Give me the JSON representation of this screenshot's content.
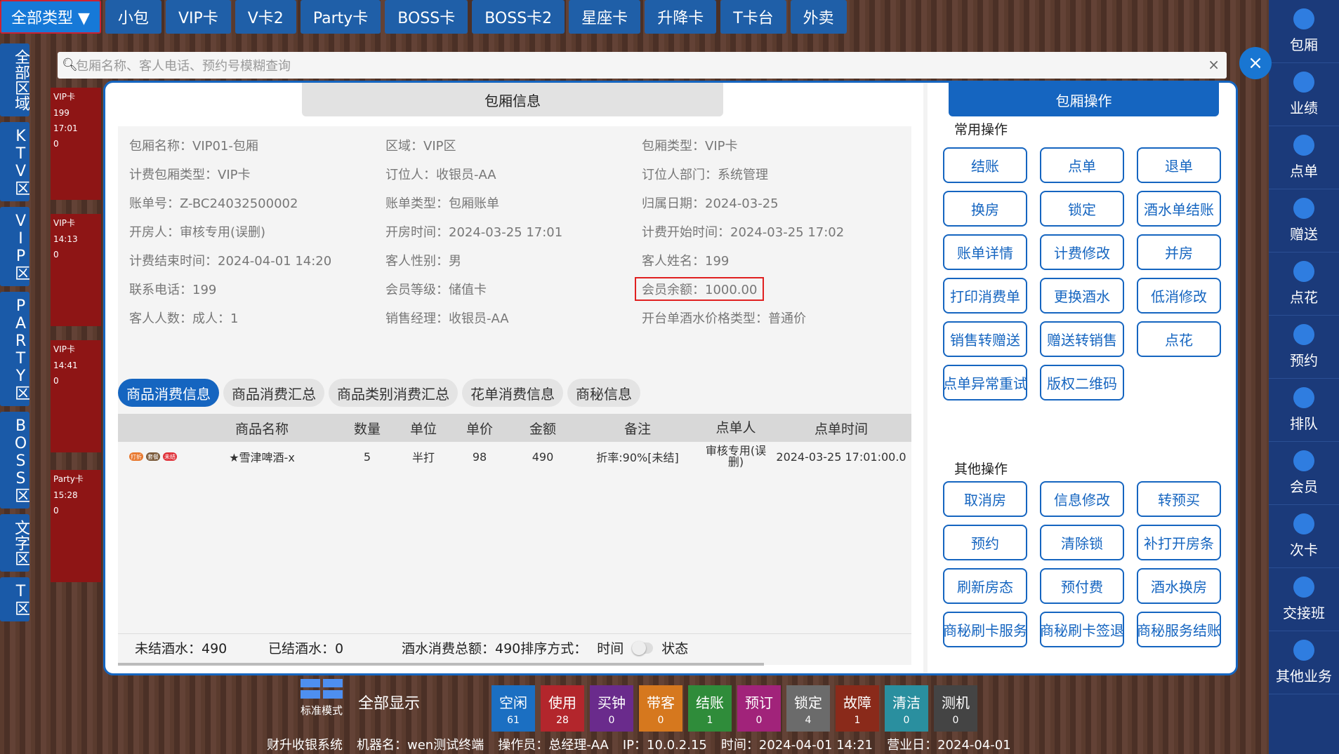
{
  "top_tabs": [
    "全部类型 ▼",
    "小包",
    "VIP卡",
    "V卡2",
    "Party卡",
    "BOSS卡",
    "BOSS卡2",
    "星座卡",
    "升降卡",
    "T卡台",
    "外卖"
  ],
  "left_rail": [
    "全部区域",
    "KTV区",
    "VIP区",
    "PARTY区",
    "BOSS区",
    "文字区",
    "T区"
  ],
  "right_rail": [
    "包厢",
    "业绩",
    "点单",
    "赠送",
    "点花",
    "预约",
    "排队",
    "会员",
    "次卡",
    "交接班",
    "其他业务"
  ],
  "search": {
    "placeholder": "包厢名称、客人电话、预约号模糊查询"
  },
  "modal": {
    "title": "包厢信息",
    "info": [
      "包厢名称：VIP01-包厢",
      "区域：VIP区",
      "包厢类型：VIP卡",
      "计费包厢类型：VIP卡",
      "订位人：收银员-AA",
      "订位人部门：系统管理",
      "账单号：Z-BC24032500002",
      "账单类型：包厢账单",
      "归属日期：2024-03-25",
      "开房人：审核专用(误删)",
      "开房时间：2024-03-25 17:01",
      "计费开始时间：2024-03-25 17:02",
      "计费结束时间：2024-04-01 14:20",
      "客人性别：男",
      "客人姓名：199",
      "联系电话：199",
      "会员等级：储值卡",
      "会员余额：1000.00",
      "客人人数：成人：1",
      "销售经理：收银员-AA",
      "开台单酒水价格类型：普通价"
    ],
    "tabs": [
      "商品消费信息",
      "商品消费汇总",
      "商品类别消费汇总",
      "花单消费信息",
      "商秘信息"
    ],
    "table_headers": [
      "",
      "商品名称",
      "数量",
      "单位",
      "单价",
      "金额",
      "备注",
      "点单人",
      "点单时间"
    ],
    "rows": [
      {
        "tags": [
          "打折",
          "套餐",
          "未结"
        ],
        "name": "★雪津啤酒-x",
        "qty": "5",
        "unit": "半打",
        "price": "98",
        "amount": "490",
        "note": "折率:90%[未结]",
        "orderer": "审核专用(误删)",
        "time": "2024-03-25 17:01:00.0"
      }
    ],
    "summary": {
      "unsettled": "未结酒水：490",
      "settled": "已结酒水：0",
      "total": "酒水消费总额：490排序方式：",
      "sort_time": "时间",
      "sort_status": "状态"
    }
  },
  "ops": {
    "title": "包厢操作",
    "common_label": "常用操作",
    "common": [
      "结账",
      "点单",
      "退单",
      "换房",
      "锁定",
      "酒水单结账",
      "账单详情",
      "计费修改",
      "并房",
      "打印消费单",
      "更换酒水",
      "低消修改",
      "销售转赠送",
      "赠送转销售",
      "点花",
      "点单异常重试",
      "版权二维码"
    ],
    "other_label": "其他操作",
    "other": [
      "取消房",
      "信息修改",
      "转预买",
      "预约",
      "清除锁",
      "补打开房条",
      "刷新房态",
      "预付费",
      "酒水换房",
      "商秘刷卡服务",
      "商秘刷卡签退",
      "商秘服务结账"
    ]
  },
  "bottom": {
    "mode": "标准模式",
    "show_all": "全部显示",
    "statuses": [
      {
        "label": "空闲",
        "count": "61",
        "color": "#1b6fc2"
      },
      {
        "label": "使用",
        "count": "28",
        "color": "#b3262c"
      },
      {
        "label": "买钟",
        "count": "0",
        "color": "#6a2b8c"
      },
      {
        "label": "带客",
        "count": "0",
        "color": "#d6781e"
      },
      {
        "label": "结账",
        "count": "1",
        "color": "#2f8c3a"
      },
      {
        "label": "预订",
        "count": "0",
        "color": "#a1237a"
      },
      {
        "label": "锁定",
        "count": "4",
        "color": "#6b6b6b"
      },
      {
        "label": "故障",
        "count": "1",
        "color": "#8a2a1a"
      },
      {
        "label": "清洁",
        "count": "0",
        "color": "#2a8f9f"
      },
      {
        "label": "测机",
        "count": "0",
        "color": "#444444"
      }
    ],
    "footer": [
      "财升收银系统",
      "机器名：wen测试终端",
      "操作员：总经理-AA",
      "IP：10.0.2.15",
      "时间：2024-04-01 14:21",
      "营业日：2024-04-01"
    ]
  },
  "rooms": [
    {
      "tag": "VIP卡",
      "l1": "199",
      "l2": "17:01",
      "l3": "0"
    },
    {
      "tag": "VIP卡",
      "l1": "14:13",
      "l2": "0",
      "l3": ""
    },
    {
      "tag": "VIP卡",
      "l1": "14:41",
      "l2": "0",
      "l3": ""
    },
    {
      "tag": "Party卡",
      "l1": "15:28",
      "l2": "0",
      "l3": ""
    }
  ]
}
